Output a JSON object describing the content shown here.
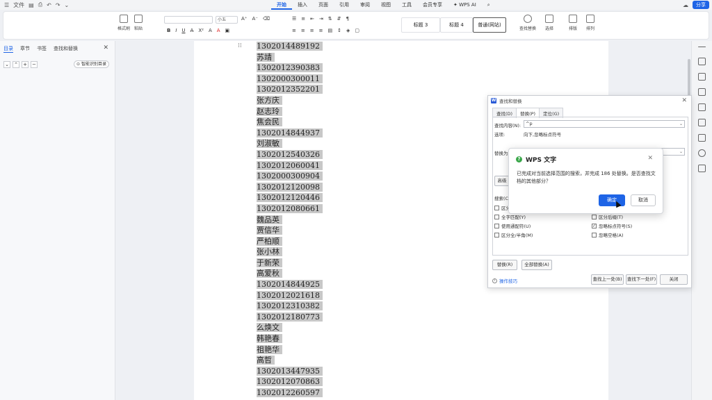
{
  "menubar": {
    "file_label": "文件",
    "tabs": [
      {
        "label": "开始",
        "active": true
      },
      {
        "label": "插入",
        "active": false
      },
      {
        "label": "页面",
        "active": false
      },
      {
        "label": "引用",
        "active": false
      },
      {
        "label": "审阅",
        "active": false
      },
      {
        "label": "视图",
        "active": false
      },
      {
        "label": "工具",
        "active": false
      },
      {
        "label": "会员专享",
        "active": false
      }
    ],
    "ai_label": "WPS AI",
    "share_label": "分享"
  },
  "ribbon": {
    "format_painter": "格式刷",
    "paste": "粘贴",
    "font_name": "",
    "font_size": "小五",
    "styles": [
      "标题 3",
      "标题 4",
      "普通(网站)"
    ],
    "find_replace": "查找替换",
    "select": "选择",
    "layout": "排版",
    "arrange": "排列"
  },
  "navpanel": {
    "tabs": [
      "目录",
      "章节",
      "书签",
      "查找和替换"
    ],
    "smart_toc": "智能识别目录"
  },
  "document": {
    "lines": [
      "1302014489192",
      "苏靖",
      "1302012390383",
      "1302000300011",
      "1302012352201",
      "张方庆",
      "赵志玲",
      "焦会民",
      "1302014844937",
      "刘淑敏",
      "1302012540326",
      "1302012060041",
      "1302000300904",
      "1302012120098",
      "1302012120446",
      "1302012080661",
      "魏品英",
      "贾信华",
      "严柏顺",
      "张小林",
      "于新荣",
      "高爱秋",
      "1302014844925",
      "1302012021618",
      "1302012310382",
      "1302012180773",
      "么焕文",
      "韩艳春",
      "祖艳华",
      "高哲",
      "1302013447935",
      "1302012070863",
      "1302012260597"
    ]
  },
  "find_dialog": {
    "title": "查找和替换",
    "tabs": [
      "查找(D)",
      "替换(P)",
      "定位(G)"
    ],
    "find_label": "查找内容(N):",
    "find_value": "^p",
    "options_label": "选项:",
    "options_value": "向下,忽略标点符号",
    "replace_label": "替换为(",
    "search_label": "搜索(C",
    "left_checks": [
      {
        "label": "区分",
        "checked": false
      },
      {
        "label": "全字匹配(Y)",
        "checked": false
      },
      {
        "label": "使用通配符(U)",
        "checked": false
      },
      {
        "label": "区分全/半角(M)",
        "checked": false
      }
    ],
    "right_checks": [
      {
        "label": "区分后缀(T)",
        "checked": false
      },
      {
        "label": "忽略标点符号(S)",
        "checked": true
      },
      {
        "label": "忽略空格(A)",
        "checked": false
      }
    ],
    "advanced_btn": "高级",
    "replace_btn": "替换(R)",
    "replace_all_btn": "全部替换(A)",
    "tips": "操作技巧",
    "find_prev_btn": "查找上一处(B)",
    "find_next_btn": "查找下一处(F)",
    "close_btn": "关闭"
  },
  "popup": {
    "title": "WPS 文字",
    "message": "已完成对当前选择范围的搜索，并完成 186 处替换。是否查找文档的其他部分？",
    "ok": "确定",
    "cancel": "取消"
  }
}
